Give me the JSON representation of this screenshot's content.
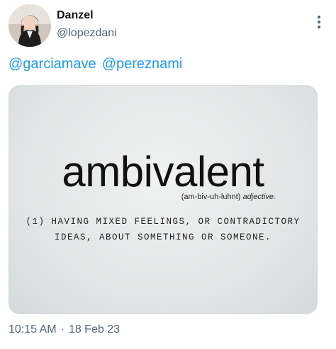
{
  "tweet": {
    "display_name": "Danzel",
    "handle": "@lopezdani",
    "mentions": [
      "@garciamave",
      "@pereznami"
    ],
    "time": "10:15 AM",
    "separator": "·",
    "date": "18 Feb 23",
    "image": {
      "word": "ambivalent",
      "pronunciation": "(am-biv-uh-luhnt)",
      "part_of_speech": "adjective.",
      "definition_line1": "(1) HAVING MIXED FEELINGS, OR CONTRADICTORY",
      "definition_line2": "IDEAS, ABOUT SOMETHING OR SOMEONE."
    }
  },
  "icons": {
    "more": "more-vertical-icon",
    "avatar": "profile-photo"
  },
  "colors": {
    "link": "#1d9bf0",
    "secondary_text": "#536471",
    "primary_text": "#0f1419"
  }
}
